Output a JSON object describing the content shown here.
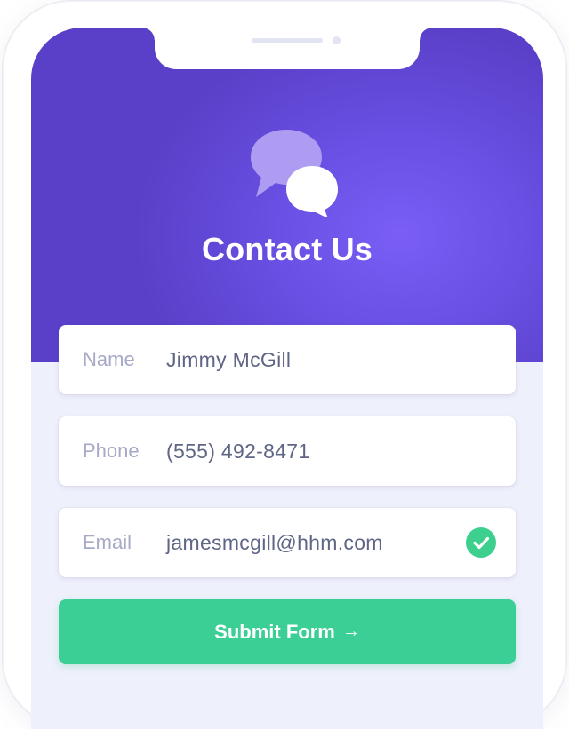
{
  "header": {
    "title": "Contact Us",
    "icon": "chat-bubbles-icon"
  },
  "form": {
    "fields": [
      {
        "label": "Name",
        "value": "Jimmy McGill",
        "valid": false
      },
      {
        "label": "Phone",
        "value": "(555) 492-8471",
        "valid": false
      },
      {
        "label": "Email",
        "value": "jamesmcgill@hhm.com",
        "valid": true,
        "status_icon": "check-circle-icon"
      }
    ],
    "submit_label": "Submit Form",
    "submit_icon": "arrow-right-icon",
    "submit_arrow": "→"
  },
  "colors": {
    "primary": "#6a50e4",
    "accent": "#3ccf95",
    "background": "#eef0fb"
  }
}
